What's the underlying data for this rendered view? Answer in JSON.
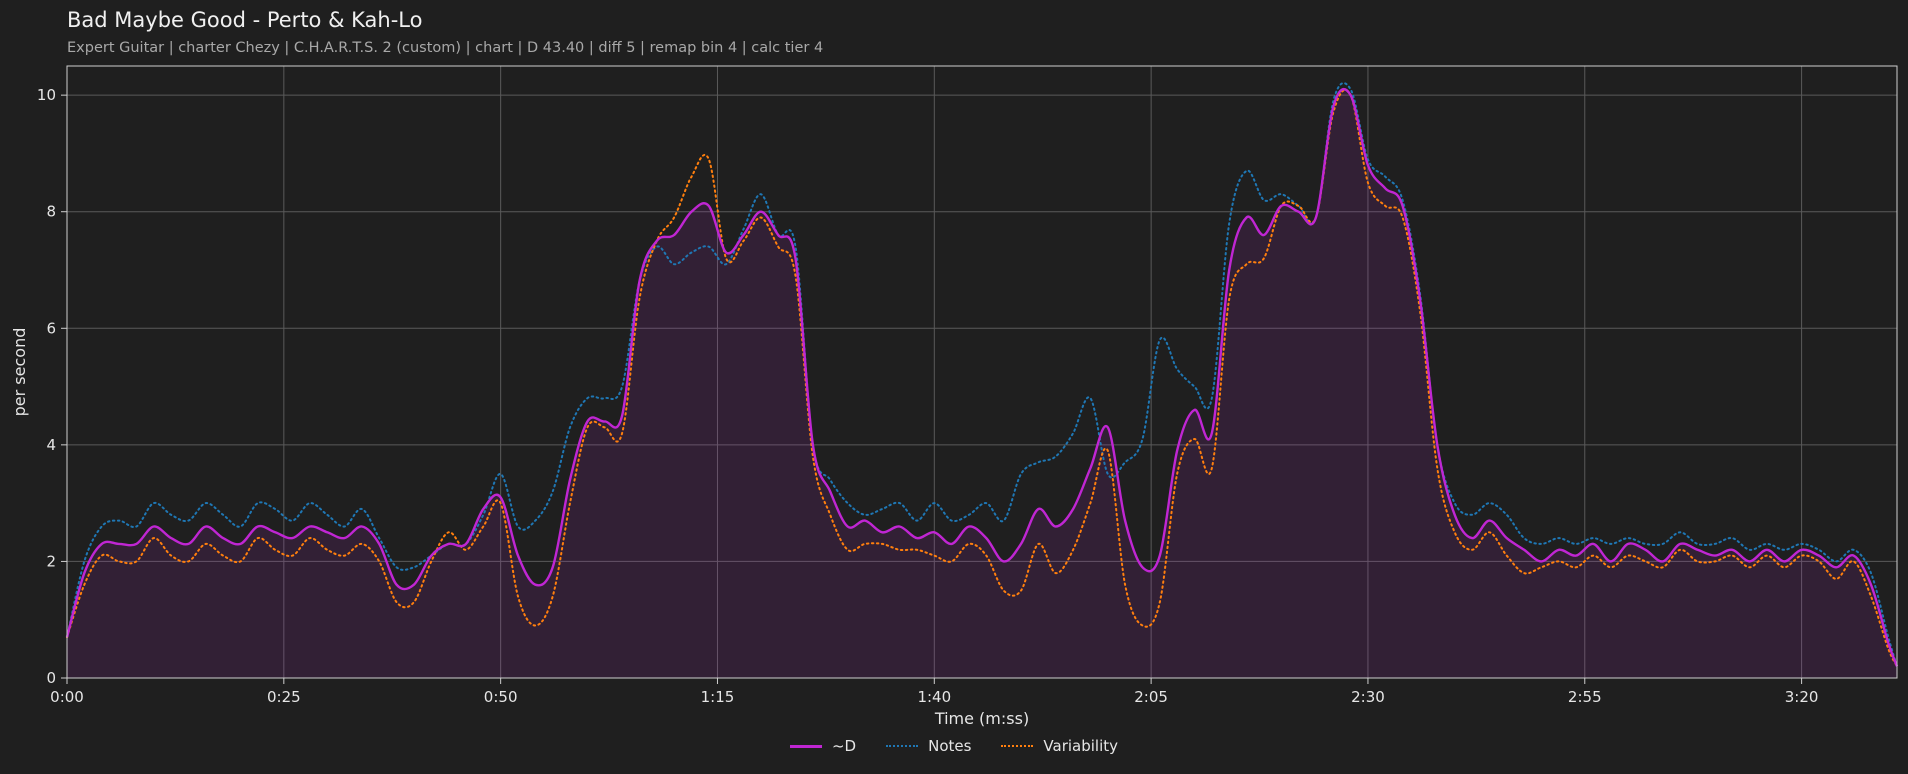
{
  "header": {
    "title": "Bad Maybe Good - Perto & Kah-Lo",
    "subtitle": "Expert Guitar  |  charter Chezy  |  C.H.A.R.T.S. 2 (custom)  |  chart  |  D 43.40  |  diff 5  |  remap bin 4  |  calc tier 4"
  },
  "chart_data": {
    "type": "line",
    "xlabel": "Time (m:ss)",
    "ylabel": "per second",
    "x_unit": "seconds",
    "xlim": [
      0,
      211
    ],
    "ylim": [
      0,
      10.5
    ],
    "x_ticks": [
      {
        "value": 0,
        "label": "0:00"
      },
      {
        "value": 25,
        "label": "0:25"
      },
      {
        "value": 50,
        "label": "0:50"
      },
      {
        "value": 75,
        "label": "1:15"
      },
      {
        "value": 100,
        "label": "1:40"
      },
      {
        "value": 125,
        "label": "2:05"
      },
      {
        "value": 150,
        "label": "2:30"
      },
      {
        "value": 175,
        "label": "2:55"
      },
      {
        "value": 200,
        "label": "3:20"
      }
    ],
    "y_ticks": [
      {
        "value": 0,
        "label": "0"
      },
      {
        "value": 2,
        "label": "2"
      },
      {
        "value": 4,
        "label": "4"
      },
      {
        "value": 6,
        "label": "6"
      },
      {
        "value": 8,
        "label": "8"
      },
      {
        "value": 10,
        "label": "10"
      }
    ],
    "grid": true,
    "legend_position": "bottom-center",
    "x": [
      0,
      2,
      4,
      6,
      8,
      10,
      12,
      14,
      16,
      18,
      20,
      22,
      24,
      26,
      28,
      30,
      32,
      34,
      36,
      38,
      40,
      42,
      44,
      46,
      48,
      50,
      52,
      54,
      56,
      58,
      60,
      62,
      64,
      66,
      68,
      70,
      72,
      74,
      76,
      78,
      80,
      82,
      84,
      86,
      88,
      90,
      92,
      94,
      96,
      98,
      100,
      102,
      104,
      106,
      108,
      110,
      112,
      114,
      116,
      118,
      120,
      122,
      124,
      126,
      128,
      130,
      132,
      134,
      136,
      138,
      140,
      142,
      144,
      146,
      148,
      150,
      152,
      154,
      156,
      158,
      160,
      162,
      164,
      166,
      168,
      170,
      172,
      174,
      176,
      178,
      180,
      182,
      184,
      186,
      188,
      190,
      192,
      194,
      196,
      198,
      200,
      202,
      204,
      206,
      208,
      210,
      211
    ],
    "series": [
      {
        "name": "~D",
        "color": "#c026d3",
        "style": "solid",
        "filled": true,
        "values": [
          0.7,
          1.8,
          2.3,
          2.3,
          2.3,
          2.6,
          2.4,
          2.3,
          2.6,
          2.4,
          2.3,
          2.6,
          2.5,
          2.4,
          2.6,
          2.5,
          2.4,
          2.6,
          2.3,
          1.6,
          1.6,
          2.1,
          2.3,
          2.3,
          2.9,
          3.1,
          2.1,
          1.6,
          1.9,
          3.4,
          4.4,
          4.4,
          4.5,
          6.8,
          7.5,
          7.6,
          8.0,
          8.1,
          7.3,
          7.6,
          8.0,
          7.6,
          7.2,
          4.0,
          3.2,
          2.6,
          2.7,
          2.5,
          2.6,
          2.4,
          2.5,
          2.3,
          2.6,
          2.4,
          2.0,
          2.3,
          2.9,
          2.6,
          2.9,
          3.6,
          4.3,
          2.7,
          1.9,
          2.1,
          3.9,
          4.6,
          4.2,
          7.0,
          7.9,
          7.6,
          8.1,
          8.0,
          7.9,
          9.8,
          10.0,
          8.8,
          8.4,
          8.1,
          6.5,
          4.0,
          2.8,
          2.4,
          2.7,
          2.4,
          2.2,
          2.0,
          2.2,
          2.1,
          2.3,
          2.0,
          2.3,
          2.2,
          2.0,
          2.3,
          2.2,
          2.1,
          2.2,
          2.0,
          2.2,
          2.0,
          2.2,
          2.1,
          1.9,
          2.1,
          1.6,
          0.6,
          0.2
        ]
      },
      {
        "name": "Notes",
        "color": "#1f77b4",
        "style": "dotted",
        "values": [
          0.7,
          2.0,
          2.6,
          2.7,
          2.6,
          3.0,
          2.8,
          2.7,
          3.0,
          2.8,
          2.6,
          3.0,
          2.9,
          2.7,
          3.0,
          2.8,
          2.6,
          2.9,
          2.4,
          1.9,
          1.9,
          2.1,
          2.3,
          2.3,
          2.8,
          3.5,
          2.6,
          2.7,
          3.2,
          4.3,
          4.8,
          4.8,
          5.0,
          6.8,
          7.4,
          7.1,
          7.3,
          7.4,
          7.1,
          7.7,
          8.3,
          7.6,
          7.4,
          4.0,
          3.4,
          3.0,
          2.8,
          2.9,
          3.0,
          2.7,
          3.0,
          2.7,
          2.8,
          3.0,
          2.7,
          3.5,
          3.7,
          3.8,
          4.2,
          4.8,
          3.5,
          3.7,
          4.1,
          5.8,
          5.3,
          5.0,
          4.8,
          7.8,
          8.7,
          8.2,
          8.3,
          8.1,
          7.9,
          9.9,
          10.1,
          8.9,
          8.6,
          8.2,
          6.6,
          4.0,
          3.0,
          2.8,
          3.0,
          2.8,
          2.4,
          2.3,
          2.4,
          2.3,
          2.4,
          2.3,
          2.4,
          2.3,
          2.3,
          2.5,
          2.3,
          2.3,
          2.4,
          2.2,
          2.3,
          2.2,
          2.3,
          2.2,
          2.0,
          2.2,
          1.8,
          0.7,
          0.2
        ]
      },
      {
        "name": "Variability",
        "color": "#ff7f0e",
        "style": "dotted",
        "values": [
          0.7,
          1.6,
          2.1,
          2.0,
          2.0,
          2.4,
          2.1,
          2.0,
          2.3,
          2.1,
          2.0,
          2.4,
          2.2,
          2.1,
          2.4,
          2.2,
          2.1,
          2.3,
          2.0,
          1.3,
          1.3,
          2.0,
          2.5,
          2.2,
          2.6,
          3.0,
          1.4,
          0.9,
          1.4,
          3.0,
          4.3,
          4.3,
          4.2,
          6.5,
          7.5,
          7.9,
          8.6,
          8.9,
          7.2,
          7.5,
          7.9,
          7.4,
          6.9,
          3.8,
          2.8,
          2.2,
          2.3,
          2.3,
          2.2,
          2.2,
          2.1,
          2.0,
          2.3,
          2.1,
          1.5,
          1.5,
          2.3,
          1.8,
          2.2,
          3.0,
          3.9,
          1.6,
          0.9,
          1.3,
          3.5,
          4.1,
          3.6,
          6.5,
          7.1,
          7.2,
          8.1,
          8.1,
          7.9,
          9.7,
          10.0,
          8.5,
          8.1,
          7.9,
          6.3,
          3.6,
          2.5,
          2.2,
          2.5,
          2.1,
          1.8,
          1.9,
          2.0,
          1.9,
          2.1,
          1.9,
          2.1,
          2.0,
          1.9,
          2.2,
          2.0,
          2.0,
          2.1,
          1.9,
          2.1,
          1.9,
          2.1,
          2.0,
          1.7,
          2.0,
          1.4,
          0.5,
          0.2
        ]
      }
    ]
  }
}
